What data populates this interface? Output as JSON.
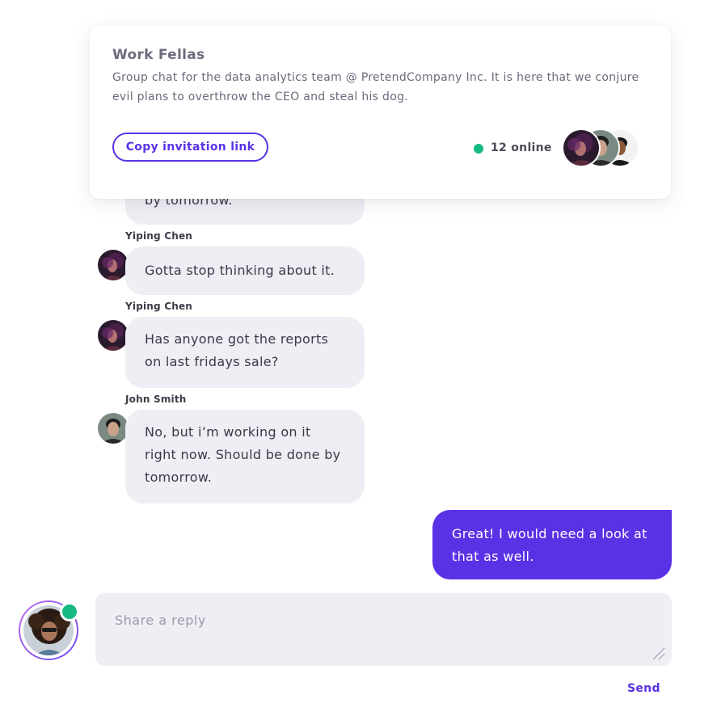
{
  "header": {
    "title": "Work Fellas",
    "description": "Group chat for the data analytics team @ PretendCompany Inc. It is here that we conjure evil plans to overthrow the CEO and steal his dog.",
    "invite_label": "Copy invitation link",
    "online_label": "12 online",
    "online_color": "#15b981"
  },
  "messages": [
    {
      "text": "by tomorrow."
    },
    {
      "sender": "Yiping Chen",
      "text": "Gotta stop thinking about it."
    },
    {
      "sender": "Yiping Chen",
      "text": "Has anyone got the reports on last fridays sale?"
    },
    {
      "sender": "John Smith",
      "text": "No, but i’m working on it right now. Should be done by tomorrow."
    },
    {
      "sender": "",
      "text": "Great! I would need a look at that as well.",
      "outgoing": true
    }
  ],
  "composer": {
    "placeholder": "Share a reply",
    "send_label": "Send"
  },
  "colors": {
    "accent": "#5a32e6",
    "bubble_incoming": "#eeeef4",
    "online": "#15b981"
  }
}
